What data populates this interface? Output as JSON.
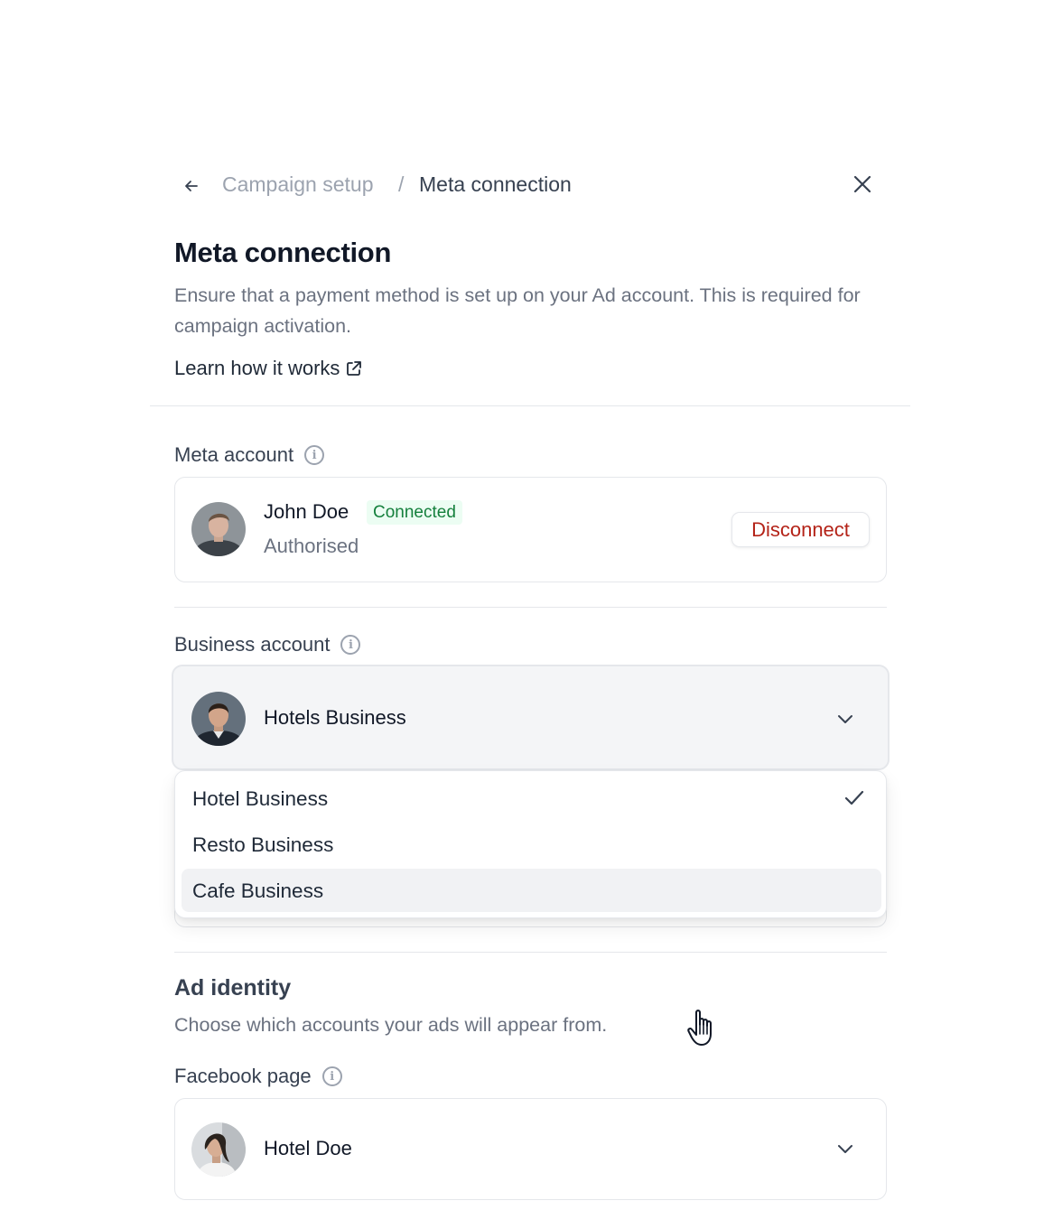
{
  "breadcrumb": {
    "parent": "Campaign setup",
    "separator": "/",
    "current": "Meta connection"
  },
  "header": {
    "title": "Meta connection",
    "description": "Ensure that a payment method is set up on your Ad account. This is required for campaign activation.",
    "learn_link": "Learn how it works"
  },
  "meta_account": {
    "label": "Meta account",
    "name": "John Doe",
    "badge": "Connected",
    "status": "Authorised",
    "disconnect_label": "Disconnect"
  },
  "business_account": {
    "label": "Business account",
    "selected": "Hotels Business",
    "options": [
      {
        "label": "Hotel Business",
        "checked": true
      },
      {
        "label": "Resto Business",
        "checked": false
      },
      {
        "label": "Cafe Business",
        "checked": false,
        "hovered": true
      }
    ]
  },
  "ad_identity": {
    "title": "Ad identity",
    "description": "Choose which accounts your ads will appear from.",
    "facebook_page": {
      "label": "Facebook page",
      "selected": "Hotel Doe"
    }
  },
  "icons": {
    "back": "arrow-left-icon",
    "close": "close-icon",
    "external": "external-link-icon",
    "info": "info-icon",
    "chevron": "chevron-down-icon",
    "check": "check-icon",
    "cursor": "hand-pointer-icon"
  },
  "colors": {
    "badge_bg": "#ecfdf3",
    "badge_text": "#15803d",
    "danger": "#b42318",
    "muted": "#6b7280"
  }
}
